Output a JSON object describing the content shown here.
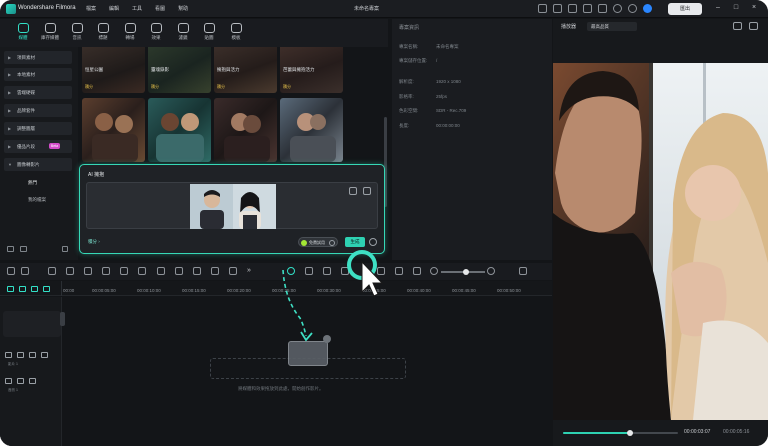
{
  "app": {
    "name": "Wondershare Filmora",
    "menus": [
      "檔案",
      "編輯",
      "工具",
      "看圖",
      "幫助"
    ],
    "project_name": "未命名專案",
    "export_label": "匯出"
  },
  "toolbar": {
    "tabs": [
      {
        "label": "媒體",
        "icon": "media-icon",
        "active": true
      },
      {
        "label": "庫存媒體",
        "icon": "stock-icon",
        "active": false
      },
      {
        "label": "音訊",
        "icon": "audio-icon",
        "active": false
      },
      {
        "label": "標題",
        "icon": "title-icon",
        "active": false
      },
      {
        "label": "轉場",
        "icon": "transition-icon",
        "active": false
      },
      {
        "label": "效果",
        "icon": "effects-icon",
        "active": false
      },
      {
        "label": "濾鏡",
        "icon": "filter-icon",
        "active": false
      },
      {
        "label": "貼圖",
        "icon": "sticker-icon",
        "active": false
      },
      {
        "label": "模板",
        "icon": "template-icon",
        "active": false
      }
    ]
  },
  "sidebar": {
    "items": [
      {
        "label": "項目素材"
      },
      {
        "label": "本地素材"
      },
      {
        "label": "雲端硬碟"
      },
      {
        "label": "品牌套件"
      },
      {
        "label": "調整圖層"
      },
      {
        "label": "優品片段",
        "badge": "Beta"
      },
      {
        "label": "圖像轉影片"
      }
    ],
    "subitems": [
      "熱門",
      "我的檔案"
    ]
  },
  "grid": {
    "row1": [
      "恒星公園",
      "靈魂錄影",
      "擁抱與活力",
      "芭蕾與擁抱活力"
    ],
    "row1_badge": "積分"
  },
  "ai_dialog": {
    "title": "AI 擁抱",
    "credit_label": "積分 ›",
    "free_label": "免費試用",
    "generate_label": "生成"
  },
  "props": {
    "title": "專案資訊",
    "rows": [
      {
        "k": "專案名稱:",
        "v": "未命名專案"
      },
      {
        "k": "專案儲存位置:",
        "v": "/"
      },
      {
        "k": "解析度:",
        "v": "1920 x 1080"
      },
      {
        "k": "影格率:",
        "v": "25fps"
      },
      {
        "k": "色彩空間:",
        "v": "SDR - Rec.709"
      },
      {
        "k": "長度:",
        "v": "00:00:00:00"
      }
    ]
  },
  "preview": {
    "player_label": "播放器",
    "quality": "最高品質",
    "timecode_current": "00:00:03:07",
    "timecode_total": "00:00:05:16",
    "playhead_progress": 0.58
  },
  "timeline": {
    "ticks": [
      "00:00",
      "00:00:05:00",
      "00:00:10:00",
      "00:00:15:00",
      "00:00:20:00",
      "00:00:25:00",
      "00:00:30:00",
      "00:00:35:00",
      "00:00:40:00",
      "00:00:45:00",
      "00:00:50:00"
    ],
    "tracks": [
      {
        "label": "影片 1"
      },
      {
        "label": "音訊 1"
      }
    ],
    "drop_hint": "將媒體和效果拖放到此處，開始創作影片。"
  }
}
